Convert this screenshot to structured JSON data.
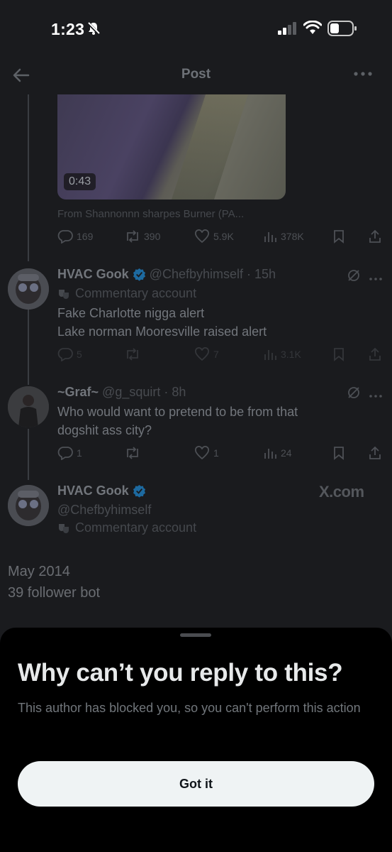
{
  "status_bar": {
    "time": "1:23"
  },
  "header": {
    "title": "Post"
  },
  "main_post": {
    "video_duration": "0:43",
    "source": "From Shannonnn sharpes Burner (PA...",
    "replies": "169",
    "reposts": "390",
    "likes": "5.9K",
    "views": "378K"
  },
  "reply1": {
    "name": "HVAC Gook",
    "handle": "@Chefbyhimself",
    "time": "· 15h",
    "label": "Commentary account",
    "lines": [
      "Fake Charlotte nigga alert",
      "Lake norman Mooresville raised alert"
    ],
    "replies": "5",
    "reposts": "",
    "likes": "7",
    "views": "3.1K"
  },
  "reply2": {
    "name": "~Graf~",
    "handle": "@g_squirt",
    "time": "· 8h",
    "lines": [
      "Who would want to pretend to be from that",
      "dogshit ass city?"
    ],
    "replies": "1",
    "reposts": "",
    "likes": "1",
    "views": "24"
  },
  "author_card": {
    "name": "HVAC Gook",
    "handle": "@Chefbyhimself",
    "label": "Commentary account",
    "watermark": "X.com"
  },
  "bio": {
    "joined": "May 2014",
    "followers": "39 follower bot"
  },
  "sheet": {
    "title": "Why can’t you reply to this?",
    "body": "This author has blocked you, so you can't perform this action",
    "button": "Got it"
  },
  "colors": {
    "background": "#1a1b1e",
    "sheet": "#000000",
    "button": "#eff3f4",
    "verified": "#1d9bf0"
  }
}
